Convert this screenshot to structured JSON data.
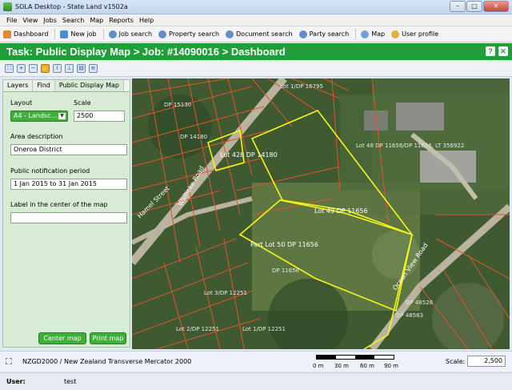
{
  "window": {
    "title": "SOLA Desktop - State Land v1502a"
  },
  "menu": [
    "File",
    "View",
    "Jobs",
    "Search",
    "Map",
    "Reports",
    "Help"
  ],
  "toolbar": [
    {
      "label": "Dashboard",
      "icon": "home-icon"
    },
    {
      "label": "New job",
      "icon": "new-job-icon"
    },
    {
      "label": "Job search",
      "icon": "search-icon"
    },
    {
      "label": "Property search",
      "icon": "search-icon"
    },
    {
      "label": "Document search",
      "icon": "search-icon"
    },
    {
      "label": "Party search",
      "icon": "search-icon"
    },
    {
      "label": "Map",
      "icon": "map-icon"
    },
    {
      "label": "User profile",
      "icon": "user-icon"
    }
  ],
  "task": {
    "title": "Task: Public Display Map > Job: #14090016 > Dashboard",
    "help": "?",
    "close": "✕"
  },
  "panel": {
    "tabs": [
      "Layers",
      "Find",
      "Public Display Map"
    ],
    "layout_label": "Layout",
    "layout_value": "A4 - Landsc...",
    "scale_label": "Scale",
    "scale_value": "2500",
    "area_label": "Area description",
    "area_value": "Oneroa District",
    "period_label": "Public notification period",
    "period_value": "1 Jan 2015 to 31 Jan 2015",
    "center_label": "Label in the center of the map",
    "center_value": "",
    "center_btn": "Center map",
    "print_btn": "Print map"
  },
  "map": {
    "labels": {
      "lot428": "Lot 428 DP 14180",
      "lot49": "Lot 49 DP 11656",
      "part50": "Part Lot 50 DP 11656",
      "lot48": "Lot 48 DP 11656/DP 11656, LT 356922",
      "lot3dp": "Lot 3/DP 12251",
      "lot2dp": "Lot 2/DP 12251",
      "lot1dp": "Lot 1/DP 12251",
      "dp11656": "DP 11656",
      "dp16795": "Lot 1/DP 16795",
      "dp15130": "DP 15130",
      "dp14180": "DP 14180",
      "dp48528": "DP 48528",
      "dp48563": "DP 48563"
    },
    "roads": [
      "Hamel Street",
      "Waiheke Road",
      "Ocean View Road"
    ]
  },
  "status": {
    "crs": "NZGD2000 / New Zealand Transverse Mercator 2000",
    "ticks": [
      "0 m",
      "30 m",
      "60 m",
      "90 m"
    ],
    "scale_label": "Scale:",
    "scale_value": "2,500"
  },
  "user": {
    "label": "User:",
    "value": "test"
  },
  "colors": {
    "accent": "#1f9e3a",
    "parcel": "#e0542c",
    "selection": "#f5f518"
  }
}
